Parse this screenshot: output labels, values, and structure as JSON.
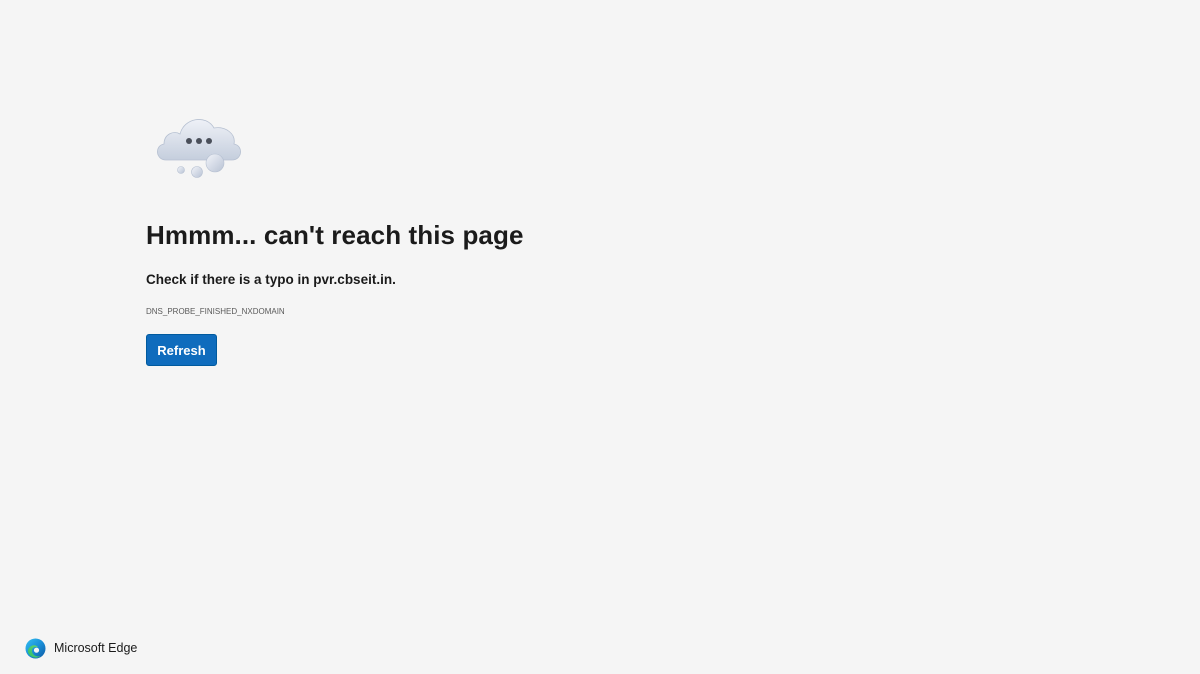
{
  "illustration": {
    "icon": "thinking-cloud-icon"
  },
  "title": "Hmmm... can't reach this page",
  "message": "Check if there is a typo in pvr.cbseit.in.",
  "error_code": "DNS_PROBE_FINISHED_NXDOMAIN",
  "refresh_label": "Refresh",
  "branding": {
    "name": "Microsoft Edge",
    "icon": "edge-logo-icon"
  },
  "colors": {
    "background": "#f5f5f5",
    "button": "#0f6cbd",
    "text": "#1b1b1b"
  }
}
